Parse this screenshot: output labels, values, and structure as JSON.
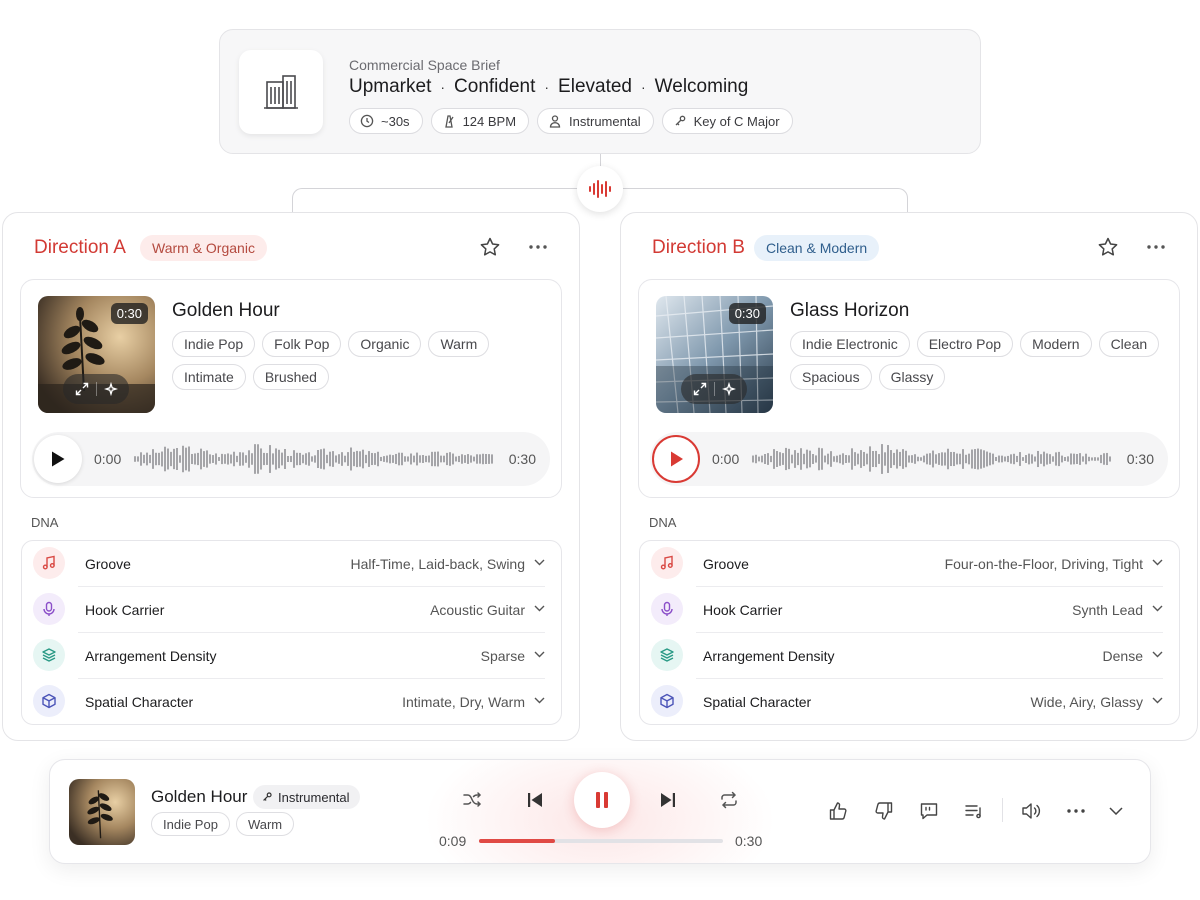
{
  "brief": {
    "kicker": "Commercial Space Brief",
    "moods": [
      "Upmarket",
      "Confident",
      "Elevated",
      "Welcoming"
    ],
    "separator": "·",
    "chips": [
      {
        "icon": "clock-icon",
        "label": "~30s"
      },
      {
        "icon": "metronome-icon",
        "label": "124 BPM"
      },
      {
        "icon": "person-icon",
        "label": "Instrumental"
      },
      {
        "icon": "key-icon",
        "label": "Key of C Major"
      }
    ]
  },
  "accent_color": "#d23a34",
  "directions": [
    {
      "title": "Direction A",
      "badge": "Warm & Organic",
      "track": {
        "name": "Golden Hour",
        "duration": "0:30",
        "tags": [
          "Indie Pop",
          "Folk Pop",
          "Organic",
          "Warm",
          "Intimate",
          "Brushed"
        ],
        "time_start": "0:00",
        "time_end": "0:30"
      },
      "dna_label": "DNA",
      "dna": [
        {
          "icon": "music-note-icon",
          "label": "Groove",
          "value": "Half-Time, Laid-back, Swing"
        },
        {
          "icon": "microphone-icon",
          "label": "Hook Carrier",
          "value": "Acoustic Guitar"
        },
        {
          "icon": "layers-icon",
          "label": "Arrangement Density",
          "value": "Sparse"
        },
        {
          "icon": "cube-icon",
          "label": "Spatial Character",
          "value": "Intimate, Dry, Warm"
        }
      ]
    },
    {
      "title": "Direction B",
      "badge": "Clean & Modern",
      "track": {
        "name": "Glass Horizon",
        "duration": "0:30",
        "tags": [
          "Indie Electronic",
          "Electro Pop",
          "Modern",
          "Clean",
          "Spacious",
          "Glassy"
        ],
        "time_start": "0:00",
        "time_end": "0:30"
      },
      "dna_label": "DNA",
      "dna": [
        {
          "icon": "music-note-icon",
          "label": "Groove",
          "value": "Four-on-the-Floor, Driving, Tight"
        },
        {
          "icon": "microphone-icon",
          "label": "Hook Carrier",
          "value": "Synth Lead"
        },
        {
          "icon": "layers-icon",
          "label": "Arrangement Density",
          "value": "Dense"
        },
        {
          "icon": "cube-icon",
          "label": "Spatial Character",
          "value": "Wide, Airy, Glassy"
        }
      ]
    }
  ],
  "now_playing": {
    "title": "Golden Hour",
    "chip": "Instrumental",
    "tags": [
      "Indie Pop",
      "Warm"
    ],
    "current_time": "0:09",
    "total_time": "0:30",
    "progress": 0.31
  }
}
